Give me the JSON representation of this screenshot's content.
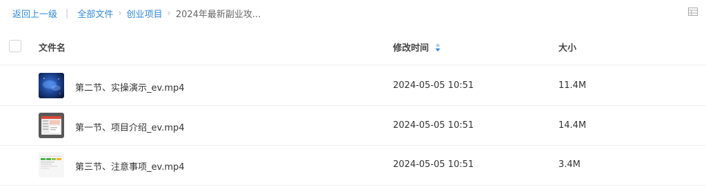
{
  "breadcrumb": {
    "back": "返回上一级",
    "separator": "|",
    "items": [
      "全部文件",
      "创业项目"
    ],
    "current": "2024年最新副业攻...",
    "chevron": "›"
  },
  "table": {
    "columns": {
      "name": "文件名",
      "time": "修改时间",
      "size": "大小"
    },
    "rows": [
      {
        "name": "第二节、实操演示_ev.mp4",
        "time": "2024-05-05 10:51",
        "size": "11.4M"
      },
      {
        "name": "第一节、项目介绍_ev.mp4",
        "time": "2024-05-05 10:51",
        "size": "14.4M"
      },
      {
        "name": "第三节、注意事项_ev.mp4",
        "time": "2024-05-05 10:51",
        "size": "3.4M"
      }
    ]
  },
  "icons": {
    "view_toggle": "grid-view-icon",
    "sort": "sort-icon",
    "thumbnails": [
      "video-thumbnail",
      "video-thumbnail",
      "video-thumbnail"
    ]
  },
  "colors": {
    "link": "#2e88d8",
    "sort_active": "#2e88d8",
    "divider": "#eeeeee"
  }
}
